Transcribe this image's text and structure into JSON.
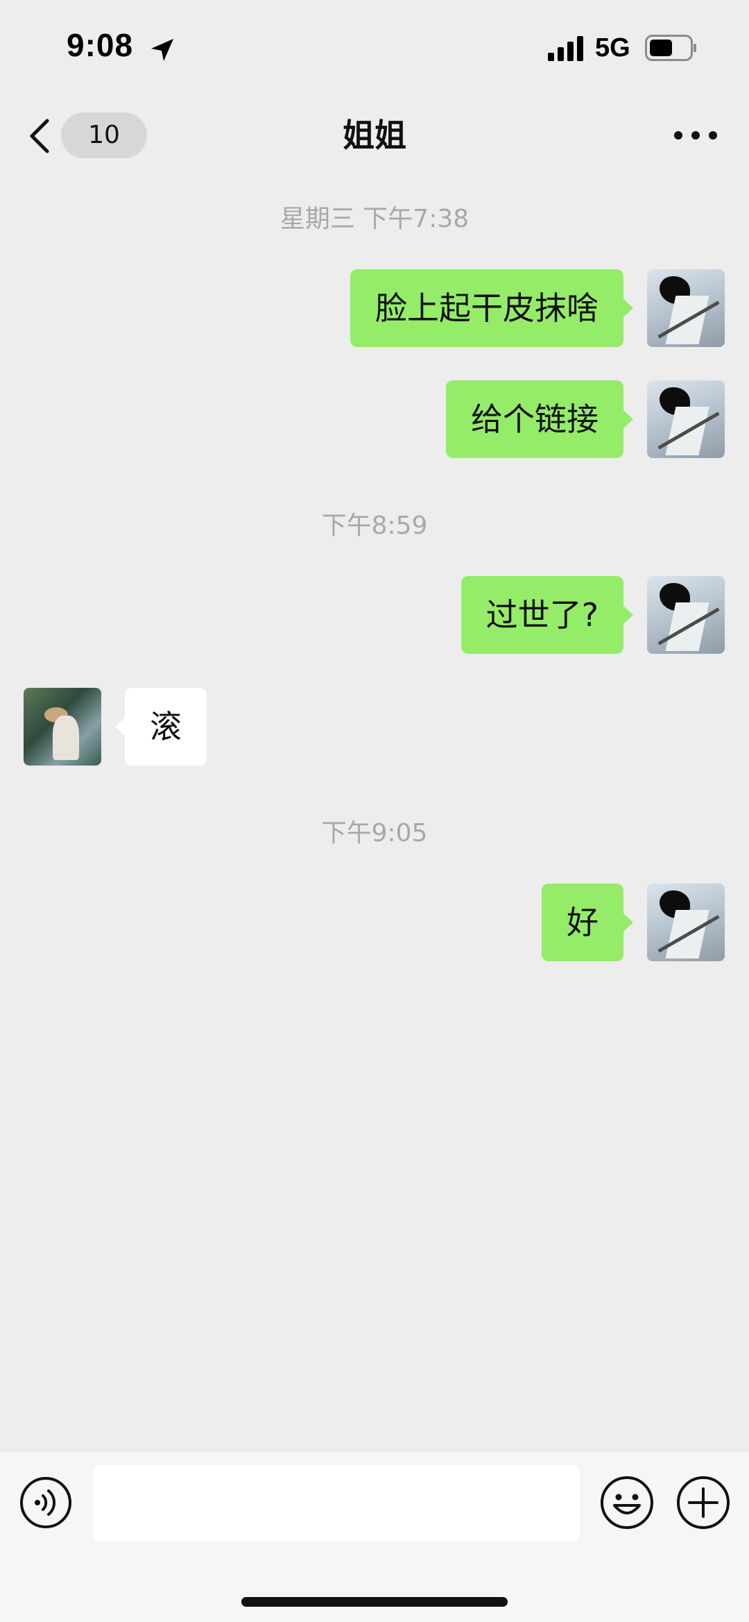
{
  "status_bar": {
    "time": "9:08",
    "network": "5G",
    "icons": [
      "location-arrow-icon",
      "cellular-signal-icon",
      "battery-icon"
    ]
  },
  "nav": {
    "back_icon": "chevron-left-icon",
    "unread_count": "10",
    "title": "姐姐",
    "more_icon": "more-dots-icon"
  },
  "messages": [
    {
      "type": "timestamp",
      "text": "星期三 下午7:38"
    },
    {
      "type": "sent",
      "text": "脸上起干皮抹啥"
    },
    {
      "type": "sent",
      "text": "给个链接"
    },
    {
      "type": "timestamp",
      "text": "下午8:59"
    },
    {
      "type": "sent",
      "text": "过世了?"
    },
    {
      "type": "received",
      "text": "滚"
    },
    {
      "type": "timestamp",
      "text": "下午9:05"
    },
    {
      "type": "sent",
      "text": "好"
    }
  ],
  "input_bar": {
    "voice_icon": "voice-icon",
    "input_value": "",
    "emoji_icon": "emoji-icon",
    "plus_icon": "plus-icon"
  },
  "colors": {
    "background": "#ededed",
    "sent_bubble": "#95ec69",
    "received_bubble": "#ffffff",
    "timestamp_text": "#a8a8a8"
  }
}
